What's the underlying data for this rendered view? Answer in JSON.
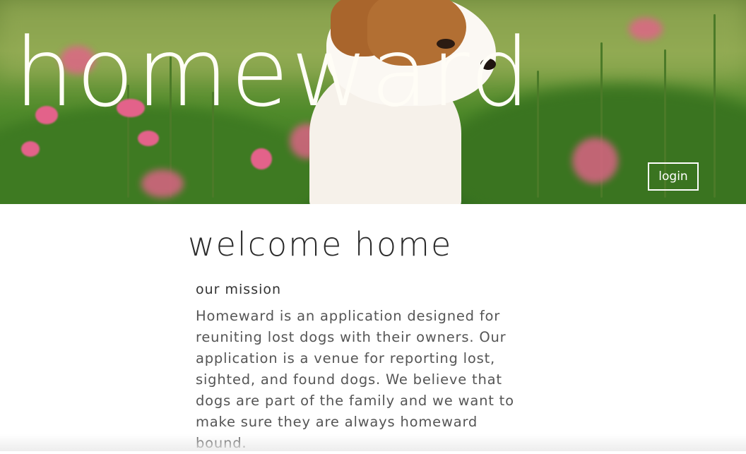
{
  "header": {
    "brand_title": "homeward",
    "login_label": "login",
    "hero_image": "puppy-in-flower-field"
  },
  "main": {
    "welcome_title": "welcome home",
    "mission_heading": "our mission",
    "mission_text": "Homeward is an application designed for reuniting lost dogs with their owners. Our application is a venue for reporting lost, sighted, and found dogs. We believe that dogs are part of the family and we want to make sure they are always homeward bound."
  },
  "colors": {
    "title_text": "#fffdf6",
    "body_text": "#555555",
    "heading_text": "#2a2a2a"
  }
}
